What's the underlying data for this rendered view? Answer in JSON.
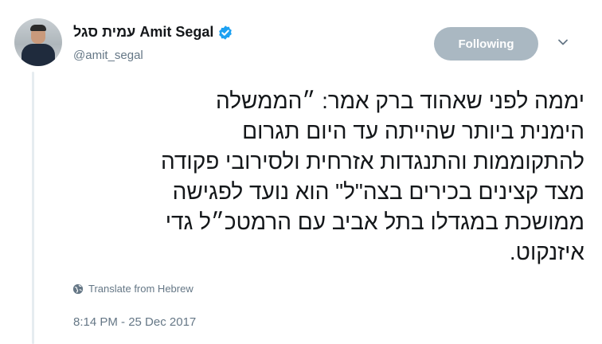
{
  "author": {
    "display_name": "עמית סגל Amit Segal",
    "handle": "@amit_segal",
    "verified": true
  },
  "follow_button": {
    "label": "Following"
  },
  "tweet": {
    "lines": [
      "יממה לפני שאהוד ברק אמר: ״הממשלה",
      "הימנית ביותר שהייתה עד היום תגרום",
      "להתקוממות והתנגדות אזרחית ולסירובי פקודה",
      "מצד קצינים בכירים בצה\"ל\" הוא נועד לפגישה",
      "ממושכת במגדלו בתל אביב עם הרמטכ״ל גדי",
      "איזנקוט."
    ]
  },
  "translate": {
    "label": "Translate from Hebrew",
    "icon": "globe-icon"
  },
  "timestamp": "8:14 PM - 25 Dec 2017",
  "colors": {
    "text": "#14171a",
    "secondary": "#657786",
    "verified": "#1da1f2",
    "following_button": "#aab8c2"
  }
}
